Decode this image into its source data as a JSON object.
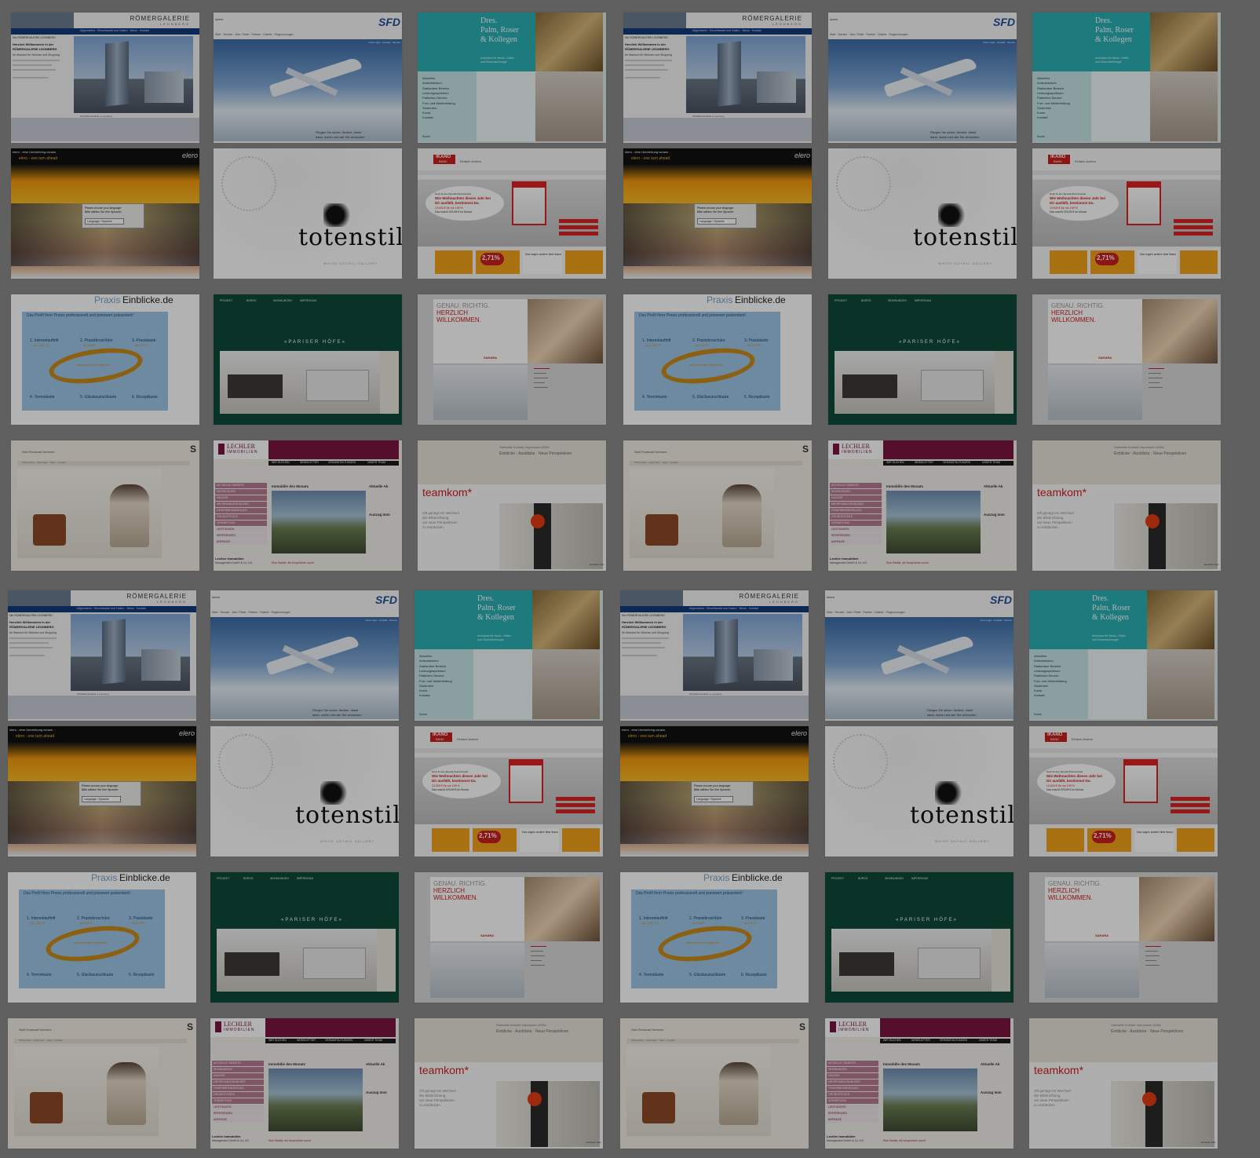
{
  "thumbs": {
    "romergalerie": {
      "logo": "RÖMERGALERIE",
      "logo_sub": "LEONBERG",
      "crumb": "Die RÖMERGALERIE LEONBERG",
      "nav": "Allgemeines · Einzelhandel und Gastro · Büros · Kontakt",
      "welcome1": "Herzlich Willkommen in der",
      "welcome2": "RÖMERGALERIE LEONBERG",
      "line1": "Ihr Standort für Wohnen und Shopping",
      "caption": "RÖMERGALERIE in Leonberg"
    },
    "sfd": {
      "small_left": "lorem",
      "logo": "SFD",
      "nav": "Start · Service · Jets / Flotte · Partner · Galerie · Flugbuchungen",
      "nav_right": "Crew Login · Kontakt · Service",
      "caption1": "Fliegen Sie sicher, flexibel, direkt",
      "caption2": "dann, wohin und wie Sie wünschen"
    },
    "palm": {
      "title1": "Dres.",
      "title2": "Palm, Roser",
      "title3": "& Kollegen",
      "sub1": "Ambulanz für Mund-, Kiefer-",
      "sub2": "und Gesichtschirurgie",
      "menu": [
        "Aktuelles",
        "Ambulatorium",
        "Stationärer Bereich",
        "Leistungsspektrum",
        "Patienten-Service",
        "Fort- und Weiterbildung",
        "Studenten",
        "Kunst",
        "Kontakt"
      ],
      "search": "Suche"
    },
    "elero": {
      "top": "elero - eine Umdrehung voraus",
      "sub": "elero - one turn ahead",
      "logo": "elero",
      "box1": "Please choose your language:",
      "box2": "Bitte wählen Sie Ihre Sprache:",
      "select": "Language / Sprache"
    },
    "totenstill": {
      "title": "totenstill",
      "sub": "WHITE GOTHIC GALLERY"
    },
    "ikano": {
      "logo1": "IKANO",
      "logo2": "BANK",
      "tag": "Einfach Anders",
      "bubble1": "Noch fix den Special Wunschzettel",
      "bubble2": "Wie Weihnachten dieses Jahr bei",
      "bubble3": "Dir ausfällt, bestimmst Du.",
      "bubble4": "13.000 € für nur 199 %",
      "bubble5": "Das macht 229,95 € im Monat",
      "rate": "2,71%",
      "box3": "Das sagen andere über Ikano"
    },
    "praxis": {
      "logo1": "Praxis",
      "logo2": "Einblicke.de",
      "banner": "Das Profil Ihrer Praxis professionell und preiswert präsentiert!",
      "step1": "1. Internetauftritt",
      "step2": "2. Praxisbroschüre",
      "step3": "3. Praxiskarte",
      "step4": "4. Terminkarte",
      "step5": "5. Glückwunschkarte",
      "step6": "6. Rezeptkarte",
      "price1": "ab 1.295,- €*",
      "price2": "ab 0,24 €*",
      "price3": "ab 0,27 €*",
      "center": "mit individuellen Angeboten"
    },
    "pariser": {
      "cols": [
        "PROJEKT",
        "BÜROS",
        "WOHNUNGEN",
        "IMPRESSUM"
      ],
      "center": "«PARISER HÖFE»"
    },
    "sahara": {
      "h1": "GENAU. RICHTIG.",
      "h2": "HERZLICH",
      "h3": "WILLKOMMEN.",
      "brand": "SAHARA"
    },
    "stoll": {
      "title": "Stoll Financial Services",
      "nav": "Philosophie · Leistungen · Team · Kontakt",
      "logo_letter": "S"
    },
    "lechler": {
      "logo1": "LECHLER",
      "logo2": "IMMOBILIEN",
      "nav": [
        "WIR SUCHEN",
        "NEWSLETTER",
        "VERANSTALTUNGEN",
        "UNSER TEAM"
      ],
      "side": [
        "AKTUELLE OBJEKTE",
        "WOHNUNGEN",
        "HÄUSER",
        "MEHRFAMILIENHÄUSER",
        "GEWERBEIMMOBILIEN",
        "GRUNDSTÜCKE",
        "VERMIETUNG",
        "LEISTUNGEN",
        "REFERENZEN",
        "ANFRAGE"
      ],
      "month": "Immobilie des Monats",
      "right": "Aktuelle Ak",
      "right2": "Auszug Imm",
      "footer1": "Lechler Immobilien",
      "footer2": "Management GmbH & Co. KG",
      "caption": "Eine Rarität, die Ansprüchen sucht"
    },
    "teamkom": {
      "nav": "Startseite  Kontakt  Impressum  AGBs",
      "sub": "Einblicke · Ausblicke · Neue Perspektiven",
      "logo": "teamkom*",
      "text1": "Oft genügt ein Wechsel",
      "text2": "der Blickrichtung,",
      "text3": "um neue Perspektiven",
      "text4": "zu entdecken.",
      "corner": "teamkom Kom"
    }
  },
  "colors": {
    "palm_teal": "#2ab0b3",
    "pariser_green": "#0e4a37",
    "lechler_maroon": "#7a1640",
    "ikano_red": "#c9201e",
    "praxis_blue": "#9ec6e6",
    "praxis_ring": "#c98a1a"
  }
}
